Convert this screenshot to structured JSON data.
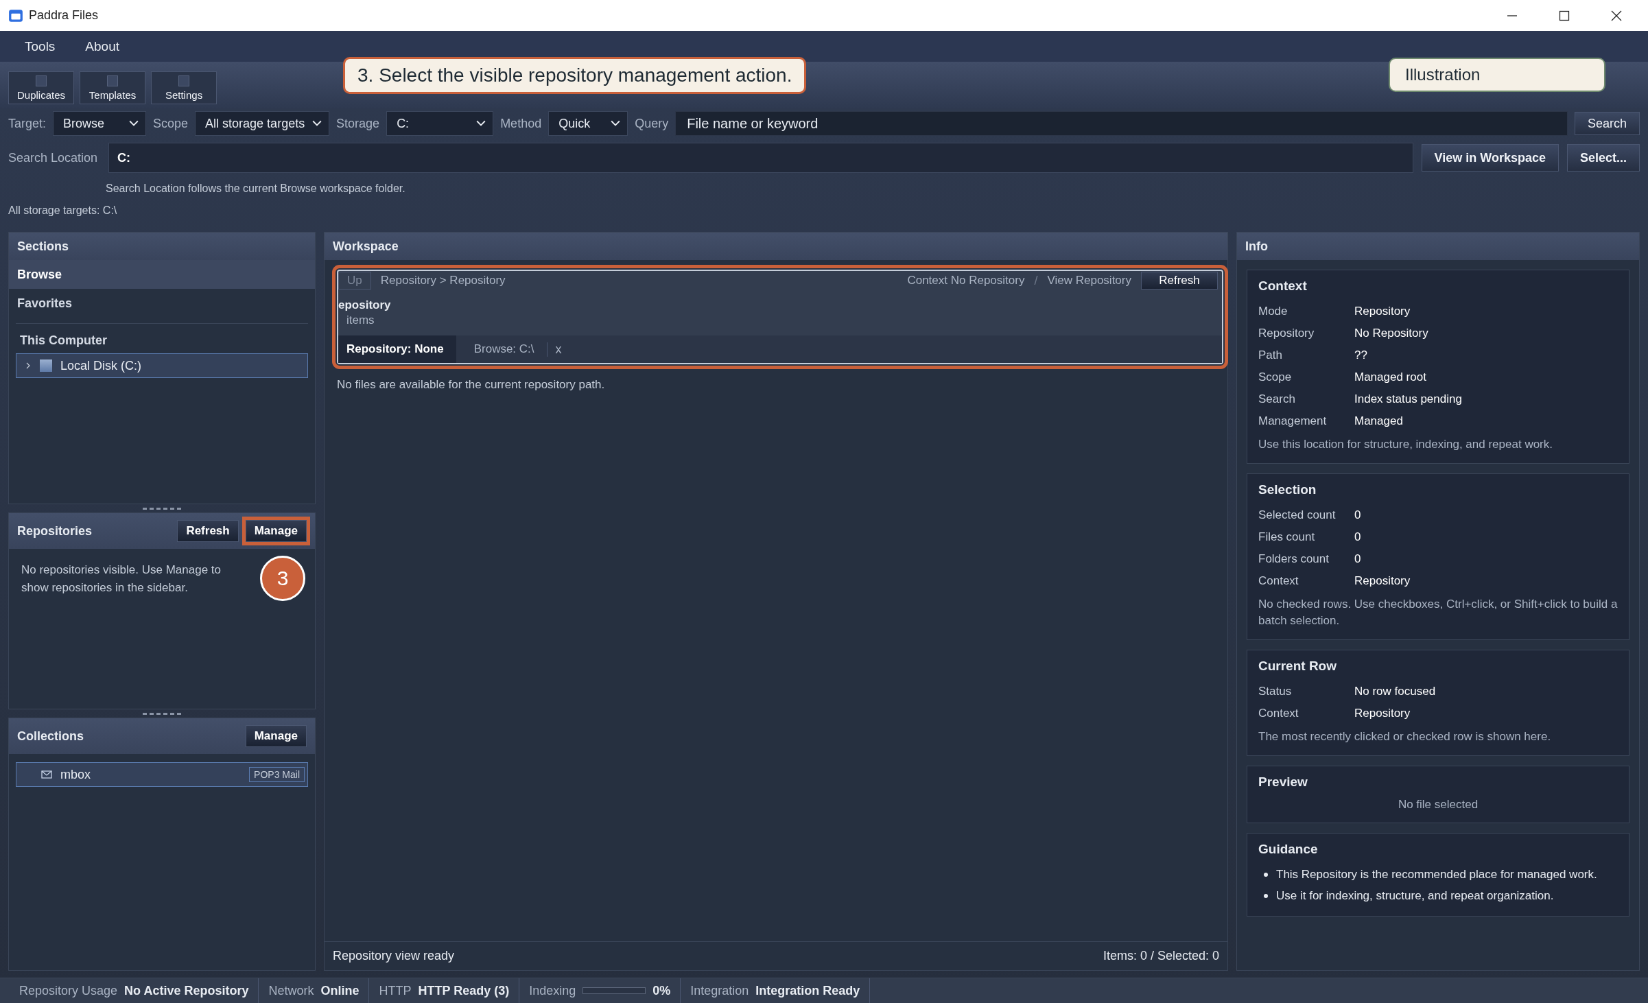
{
  "window": {
    "title": "Paddra Files"
  },
  "menu": [
    "Tools",
    "About"
  ],
  "toolbar": [
    "Duplicates",
    "Templates",
    "Settings"
  ],
  "callout": {
    "text": "3. Select the visible repository management action."
  },
  "illustration": {
    "text": "Illustration"
  },
  "filters": [
    {
      "kind": "select",
      "label": "Target:",
      "value": "Browse"
    },
    {
      "kind": "select",
      "label": "Scope",
      "value": "All storage targets"
    },
    {
      "kind": "select",
      "label": "Storage",
      "value": "C:"
    },
    {
      "kind": "select",
      "label": "Method",
      "value": "Quick"
    },
    {
      "kind": "input",
      "label": "Query",
      "placeholder": "File name or keyword"
    }
  ],
  "search_button": "Search",
  "search_location": {
    "label": "Search Location",
    "value": "C:",
    "buttons": [
      "View in Workspace",
      "Select..."
    ],
    "hint": "Search Location follows the current Browse workspace folder."
  },
  "storage_summary": "All storage targets: C:\\",
  "sections": {
    "title": "Sections",
    "items": [
      {
        "label": "Browse",
        "selected": true
      },
      {
        "label": "Favorites",
        "selected": false
      }
    ],
    "group": "This Computer",
    "tree": [
      {
        "label": "Local Disk (C:)",
        "expanded": false,
        "selected": true
      }
    ]
  },
  "repositories": {
    "title": "Repositories",
    "buttons": [
      {
        "label": "Refresh",
        "highlighted": false
      },
      {
        "label": "Manage",
        "highlighted": true
      }
    ],
    "empty": "No repositories visible. Use Manage to show repositories in the sidebar.",
    "step": "3"
  },
  "collections": {
    "title": "Collections",
    "button": "Manage",
    "items": [
      {
        "label": "mbox",
        "tag": "POP3 Mail"
      }
    ]
  },
  "workspace": {
    "title": "Workspace",
    "highlighted": true,
    "up": "Up",
    "breadcrumb": "Repository > Repository",
    "context": "Context No Repository",
    "separator": "/",
    "view": "View Repository",
    "refresh": "Refresh",
    "heading": "epository",
    "count": "items",
    "tabs": [
      {
        "label": "Repository: None",
        "selected": true
      },
      {
        "label": "Browse: C:\\",
        "selected": false
      }
    ],
    "close": "x",
    "empty": "No files are available for the current repository path.",
    "status": "Repository view ready",
    "summary": "Items: 0 / Selected: 0"
  },
  "info": {
    "title": "Info",
    "cards": [
      {
        "kind": "fields",
        "title": "Context",
        "rows": [
          [
            "Mode",
            "Repository"
          ],
          [
            "Repository",
            "No Repository"
          ],
          [
            "Path",
            "??"
          ],
          [
            "Scope",
            "Managed root"
          ],
          [
            "Search",
            "Index status pending"
          ],
          [
            "Management",
            "Managed"
          ]
        ],
        "note": "Use this location for structure, indexing, and repeat work."
      },
      {
        "kind": "fields",
        "title": "Selection",
        "rows": [
          [
            "Selected count",
            "0"
          ],
          [
            "Files count",
            "0"
          ],
          [
            "Folders count",
            "0"
          ],
          [
            "Context",
            "Repository"
          ]
        ],
        "note": "No checked rows. Use checkboxes, Ctrl+click, or Shift+click to build a batch selection."
      },
      {
        "kind": "fields",
        "title": "Current Row",
        "rows": [
          [
            "Status",
            "No row focused"
          ],
          [
            "Context",
            "Repository"
          ]
        ],
        "note": "The most recently clicked or checked row is shown here."
      },
      {
        "kind": "centered",
        "title": "Preview",
        "note": "No file selected"
      },
      {
        "kind": "bullets",
        "title": "Guidance",
        "bullets": [
          "This Repository is the recommended place for managed work.",
          "Use it for indexing, structure, and repeat organization."
        ]
      }
    ]
  },
  "status_bar": [
    {
      "kind": "text",
      "label": "Repository Usage",
      "value": "No Active Repository"
    },
    {
      "kind": "text",
      "label": "Network",
      "value": "Online"
    },
    {
      "kind": "text",
      "label": "HTTP",
      "value": "HTTP Ready (3)"
    },
    {
      "kind": "meter",
      "label": "Indexing",
      "level": 0,
      "value": "0%"
    },
    {
      "kind": "text",
      "label": "Integration",
      "value": "Integration Ready"
    }
  ]
}
